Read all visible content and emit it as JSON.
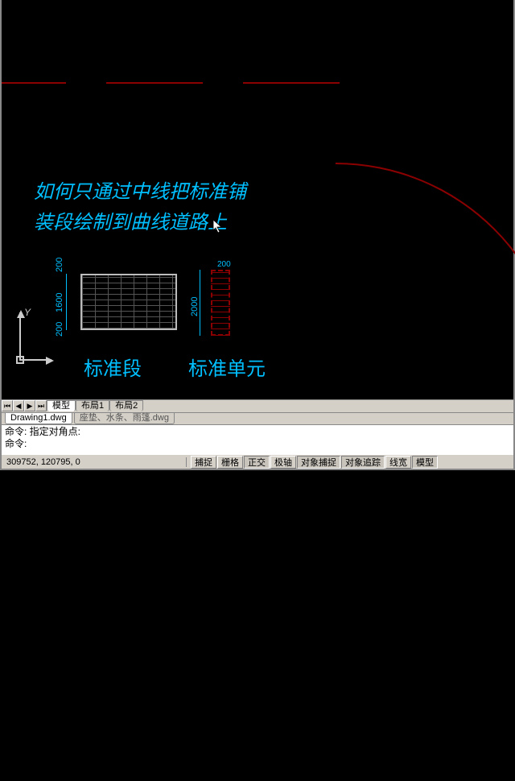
{
  "canvas": {
    "annotation_line1": "如何只通过中线把标准铺",
    "annotation_line2": "装段绘制到曲线道路上",
    "label_segment": "标准段",
    "label_unit": "标准单元",
    "ucs_y": "Y",
    "dims": {
      "h_top": "200",
      "h_mid": "1600",
      "h_bot": "200",
      "u_top": "200",
      "u_mid": "2000"
    }
  },
  "tabs": {
    "model": "模型",
    "layout1": "布局1",
    "layout2": "布局2"
  },
  "filetabs": {
    "active": "Drawing1.dwg",
    "inactive": "座垫、水条、雨篷.dwg"
  },
  "command": {
    "line1": "命令: 指定对角点:",
    "line2": "命令:"
  },
  "status": {
    "coords": "309752, 120795, 0",
    "buttons": {
      "snap": "捕捉",
      "grid": "栅格",
      "ortho": "正交",
      "polar": "极轴",
      "osnap": "对象捕捉",
      "otrack": "对象追踪",
      "lwt": "线宽",
      "model": "模型"
    }
  }
}
